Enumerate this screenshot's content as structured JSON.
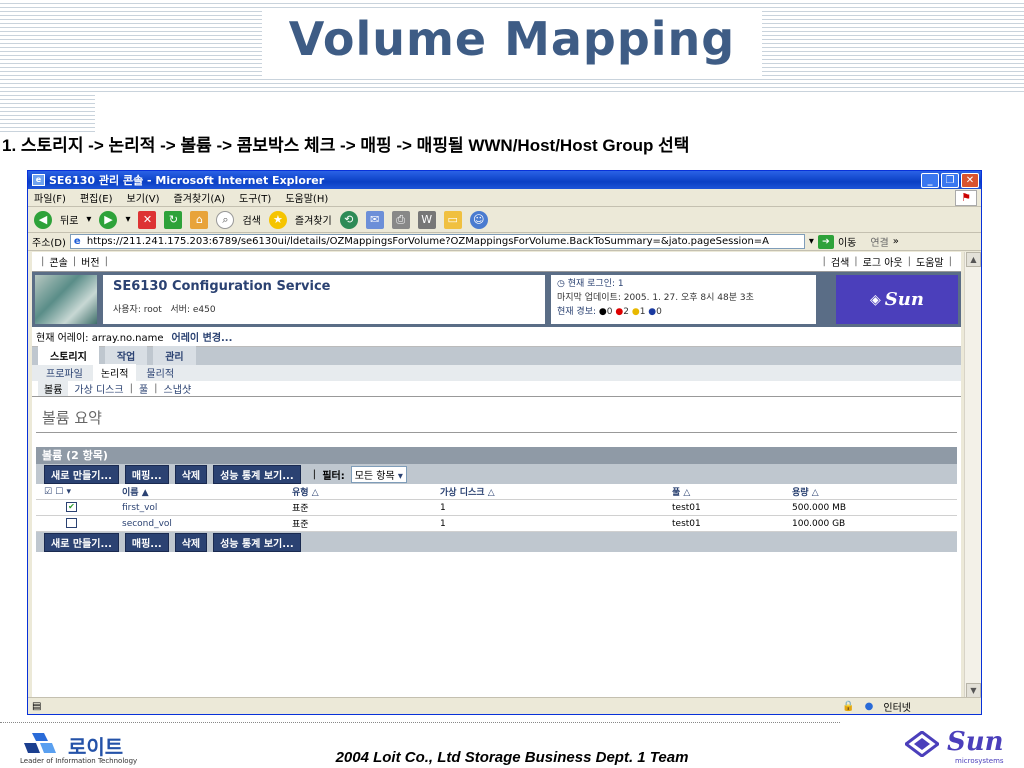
{
  "slide": {
    "title": "Volume Mapping",
    "step": "1. 스토리지 -> 논리적 -> 볼륨 -> 콤보박스 체크 -> 매핑 -> 매핑될 WWN/Host/Host Group 선택",
    "footer": "2004 Loit Co., Ltd Storage Business Dept. 1 Team",
    "company_name": "로이트",
    "company_tagline": "Leader of Information Technology",
    "sun_logo_word": "Sun",
    "sun_logo_sub": "microsystems"
  },
  "browser": {
    "title": "SE6130 관리 콘솔 - Microsoft Internet Explorer",
    "menus": [
      "파일(F)",
      "편집(E)",
      "보기(V)",
      "즐겨찾기(A)",
      "도구(T)",
      "도움말(H)"
    ],
    "toolbar": {
      "back": "뒤로",
      "search": "검색",
      "favorites": "즐겨찾기"
    },
    "address_label": "주소(D)",
    "address": "https://211.241.175.203:6789/se6130ui/ldetails/OZMappingsForVolume?OZMappingsForVolume.BackToSummary=&jato.pageSession=A",
    "go": "이동",
    "links": "연결",
    "status_zone": "인터넷"
  },
  "app": {
    "top_links_left": [
      "콘솔",
      "버전"
    ],
    "top_links_right": [
      "검색",
      "로그 아웃",
      "도움말"
    ],
    "service_title": "SE6130 Configuration Service",
    "user_label": "사용자:",
    "user": "root",
    "server_label": "서버:",
    "server": "e450",
    "current_login": "현재 로그인: 1",
    "last_update": "마지막 업데이트: 2005. 1. 27. 오후 8시 48분 3초",
    "alerts_label": "현재 경보:",
    "alerts": [
      "0",
      "2",
      "1",
      "0"
    ],
    "brand_logo": "Sun",
    "current_array_label": "현재 어레이: array.no.name",
    "change_array": "어레이 변경...",
    "tabs": [
      "스토리지",
      "작업",
      "관리"
    ],
    "subtabs": [
      "프로파일",
      "논리적",
      "물리적"
    ],
    "subsubtabs": [
      "볼륨",
      "가상 디스크",
      "풀",
      "스냅샷"
    ],
    "page_title": "볼륨 요약",
    "table_title": "볼륨 (2 항목)",
    "actions": [
      "새로 만들기...",
      "매핑...",
      "삭제",
      "성능 통계 보기..."
    ],
    "filter_label": "필터:",
    "filter_value": "모든 항목",
    "columns": [
      "이름",
      "유형",
      "가상 디스크",
      "풀",
      "용량"
    ],
    "rows": [
      {
        "name": "first_vol",
        "type": "표준",
        "vdisk": "1",
        "pool": "test01",
        "capacity": "500.000 MB",
        "checked": true
      },
      {
        "name": "second_vol",
        "type": "표준",
        "vdisk": "1",
        "pool": "test01",
        "capacity": "100.000 GB",
        "checked": false
      }
    ]
  }
}
